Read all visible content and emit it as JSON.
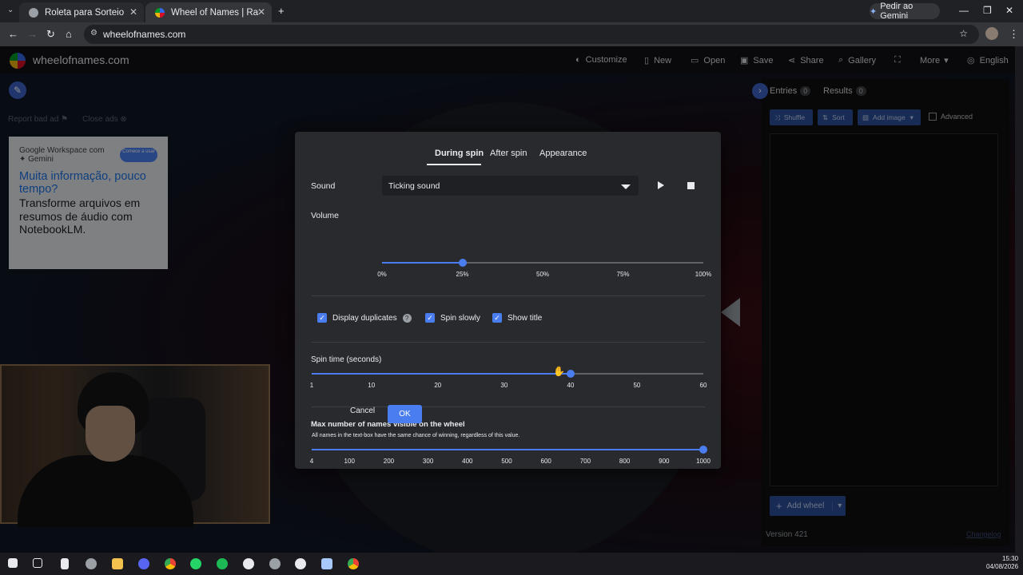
{
  "browser": {
    "tabs": [
      {
        "title": "Roleta para Sorteio"
      },
      {
        "title": "Wheel of Names | Random nam"
      }
    ],
    "gemini_button": "Pedir ao Gemini",
    "url": "wheelofnames.com"
  },
  "site": {
    "name": "wheelofnames.com",
    "header_items": [
      "Customize",
      "New",
      "Open",
      "Save",
      "Share",
      "Gallery",
      "More",
      "English"
    ]
  },
  "left": {
    "report_bad_ad": "Report bad ad",
    "close_ads": "Close ads",
    "ad": {
      "brand": "Google Workspace com ✦ Gemini",
      "cta": "Comece a usar",
      "headline": "Muita informação, pouco tempo?",
      "body": "Transforme arquivos em resumos de áudio com NotebookLM."
    }
  },
  "panel": {
    "entries_tab": "Entries",
    "entries_count": "0",
    "results_tab": "Results",
    "results_count": "0",
    "shuffle": "Shuffle",
    "sort": "Sort",
    "add_image": "Add image",
    "advanced": "Advanced",
    "add_wheel": "Add wheel",
    "version": "Version 421",
    "changelog": "Changelog"
  },
  "dialog": {
    "tabs": [
      "During spin",
      "After spin",
      "Appearance"
    ],
    "active_tab": "During spin",
    "sound_label": "Sound",
    "sound_value": "Ticking sound",
    "volume_label": "Volume",
    "volume_ticks": [
      "0%",
      "25%",
      "50%",
      "75%",
      "100%"
    ],
    "volume_value": 0.25,
    "checkboxes": [
      {
        "label": "Display duplicates",
        "checked": true
      },
      {
        "label": "Spin slowly",
        "checked": true
      },
      {
        "label": "Show title",
        "checked": true
      }
    ],
    "spin_time_label": "Spin time (seconds)",
    "spin_time_ticks": [
      "1",
      "10",
      "20",
      "30",
      "40",
      "50",
      "60"
    ],
    "spin_time_value": 40,
    "max_names_label": "Max number of names visible on the wheel",
    "max_names_desc": "All names in the text-box have the same chance of winning, regardless of this value.",
    "max_names_ticks": [
      "4",
      "100",
      "200",
      "300",
      "400",
      "500",
      "600",
      "700",
      "800",
      "900",
      "1000"
    ],
    "max_names_value": 1000,
    "cancel": "Cancel",
    "ok": "OK"
  },
  "taskbar": {
    "time": "15:30",
    "date": "04/08/2026"
  },
  "colors": {
    "accent": "#4a7ef0",
    "panel_button": "#2c4f99",
    "dialog_bg": "#292a2d"
  }
}
